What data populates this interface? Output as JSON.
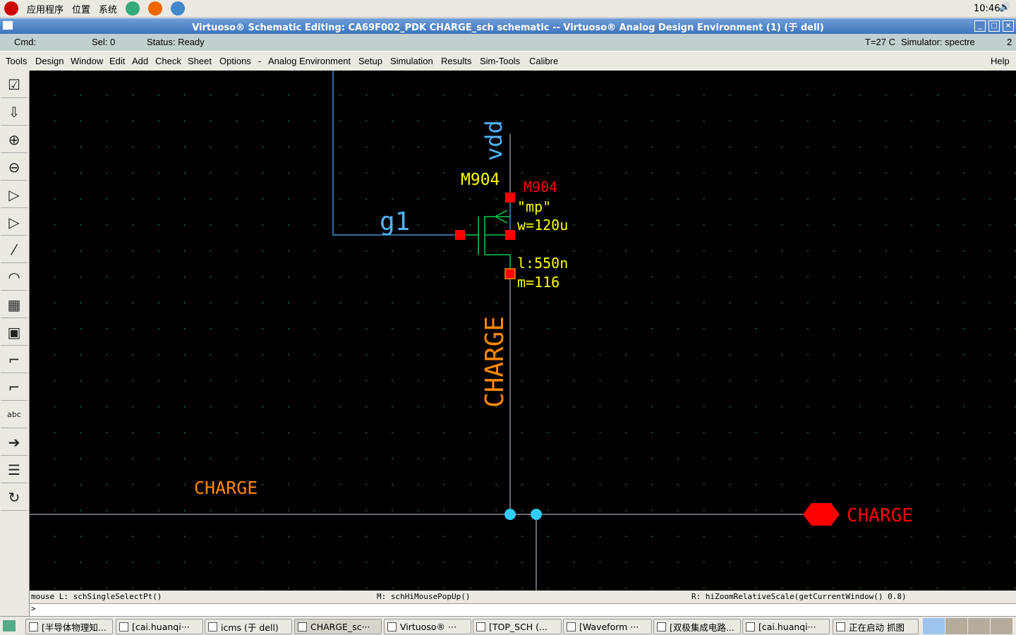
{
  "panel": {
    "apps": "应用程序",
    "places": "位置",
    "system": "系统",
    "clock": "10:46"
  },
  "window": {
    "title": "Virtuoso® Schematic Editing: CA69F002_PDK CHARGE_sch schematic -- Virtuoso® Analog Design Environment (1) (于 dell)"
  },
  "status": {
    "cmd": "Cmd:",
    "sel": "Sel: 0",
    "status": "Status: Ready",
    "temp": "T=27 C",
    "simulator": "Simulator: spectre",
    "num": "2"
  },
  "menu": [
    "Tools",
    "Design",
    "Window",
    "Edit",
    "Add",
    "Check",
    "Sheet",
    "Options",
    "-",
    "Analog Environment",
    "Setup",
    "Simulation",
    "Results",
    "Sim-Tools",
    "Calibre"
  ],
  "help": "Help",
  "tools": [
    "check-save",
    "save",
    "zoom-in",
    "zoom-out",
    "stretch",
    "copy",
    "wire",
    "wire-arc",
    "bus",
    "instance",
    "wire-narrow",
    "wire-wide",
    "label",
    "pin",
    "property",
    "undo"
  ],
  "schematic": {
    "vdd": "vdd",
    "inst_name": "M904",
    "inst_name_red": "M904",
    "model": "\"mp\"",
    "w": "w=120u",
    "l": "l:550n",
    "m": "m=116",
    "gate_net": "g1",
    "drain_net": "CHARGE",
    "wire_label": "CHARGE",
    "pin_label": "CHARGE",
    "colors": {
      "wire": "#4fb3ff",
      "device": "#00cc55",
      "label": "#ffff00",
      "pin": "#ff0000",
      "net": "#ff8000"
    }
  },
  "mouse": {
    "left": "mouse L: schSingleSelectPt()",
    "middle": "M: schHiMousePopUp()",
    "right": "R: hiZoomRelativeScale(getCurrentWindow() 0.8)"
  },
  "cmdline": ">",
  "taskbar": [
    "[半导体物理知...",
    "[cai.huanqi···",
    "icms (于 dell)",
    "CHARGE_sc···",
    "Virtuoso® ···",
    "[TOP_SCH (...",
    "[Waveform ···",
    "[双极集成电路...",
    "[cai.huanqi···",
    "正在启动 抓图"
  ]
}
